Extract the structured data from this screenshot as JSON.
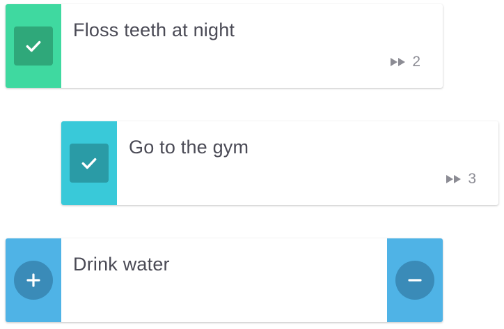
{
  "habits": [
    {
      "title": "Floss teeth at night",
      "streak": "2",
      "checked": true,
      "accent": "#3fd9a0",
      "button_color": "#2fa87a"
    },
    {
      "title": "Go to the gym",
      "streak": "3",
      "checked": true,
      "accent": "#39c9d9",
      "button_color": "#2a9ba6"
    },
    {
      "title": "Drink water",
      "accent": "#4fb3e6",
      "button_color": "#3a8bb8",
      "left_icon": "plus-icon",
      "right_icon": "minus-icon"
    }
  ],
  "icons": {
    "check": "checkmark-icon",
    "streak": "fast-forward-icon"
  }
}
